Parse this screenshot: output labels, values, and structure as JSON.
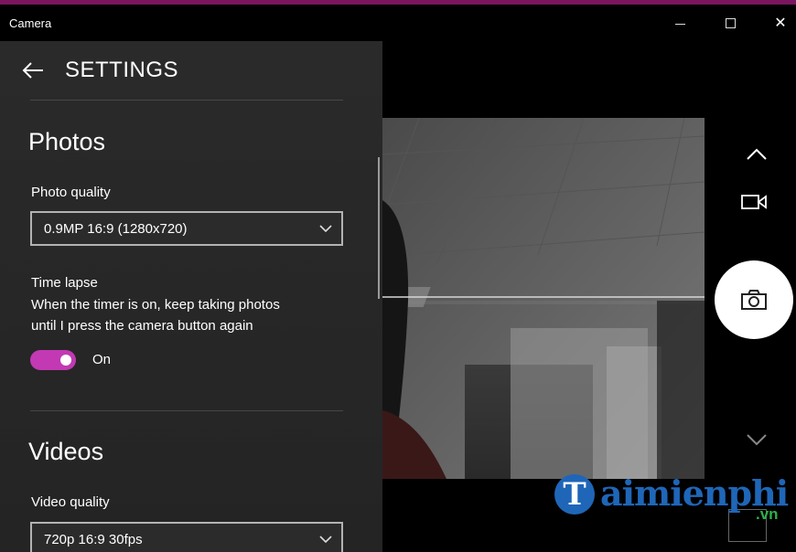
{
  "window": {
    "title": "Camera",
    "controls": {
      "minimize": "minimize",
      "maximize": "maximize",
      "close": "✕"
    },
    "accent_color": "#7a1560"
  },
  "settings": {
    "title": "SETTINGS",
    "photos": {
      "heading": "Photos",
      "photo_quality_label": "Photo quality",
      "photo_quality_value": "0.9MP 16:9 (1280x720)",
      "time_lapse_label": "Time lapse",
      "time_lapse_desc_line1": "When the timer is on, keep taking photos",
      "time_lapse_desc_line2": "until I press the camera button again",
      "time_lapse_state": "On",
      "toggle_color": "#c239b3"
    },
    "videos": {
      "heading": "Videos",
      "video_quality_label": "Video quality",
      "video_quality_value": "720p 16:9 30fps"
    }
  },
  "camera_controls": {
    "icons": [
      "chevron-up-icon",
      "video-camera-icon",
      "camera-icon",
      "chevron-down-icon"
    ]
  },
  "watermark": {
    "badge": "T",
    "text": "aimienphi",
    "sub": ".vn"
  }
}
